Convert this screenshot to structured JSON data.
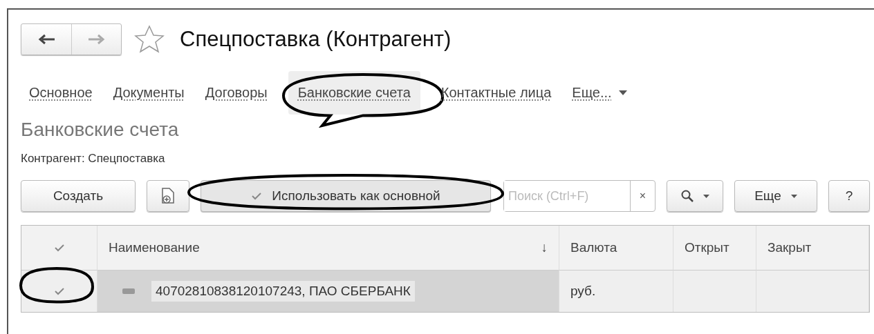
{
  "window": {
    "title": "Спецпоставка (Контрагент)",
    "favorite": false
  },
  "tabs": [
    {
      "label": "Основное",
      "selected": false,
      "circled": false
    },
    {
      "label": "Документы",
      "selected": false,
      "circled": false
    },
    {
      "label": "Договоры",
      "selected": false,
      "circled": false
    },
    {
      "label": "Банковские счета",
      "selected": true,
      "circled": true
    },
    {
      "label": "Контактные лица",
      "selected": false,
      "circled": false
    },
    {
      "label": "Еще...",
      "selected": false,
      "circled": false,
      "kind": "menu"
    }
  ],
  "section_title": "Банковские счета",
  "owner": {
    "label": "Контрагент:",
    "value": "Спецпоставка"
  },
  "toolbar": {
    "create": "Создать",
    "use_as_main": {
      "label": "Использовать как основной",
      "circled": true
    },
    "search": {
      "placeholder": "Поиск (Ctrl+F)",
      "clear": "×"
    },
    "more": "Еще",
    "help": "?"
  },
  "table": {
    "columns": [
      {
        "label": "Наименование",
        "sort": "↓"
      },
      {
        "label": "Валюта"
      },
      {
        "label": "Открыт"
      },
      {
        "label": "Закрыт"
      }
    ],
    "rows": [
      {
        "main": true,
        "circled": true,
        "selected": true,
        "name": "40702810838120107243, ПАО СБЕРБАНК",
        "currency": "руб.",
        "opened": "",
        "closed": ""
      }
    ]
  }
}
